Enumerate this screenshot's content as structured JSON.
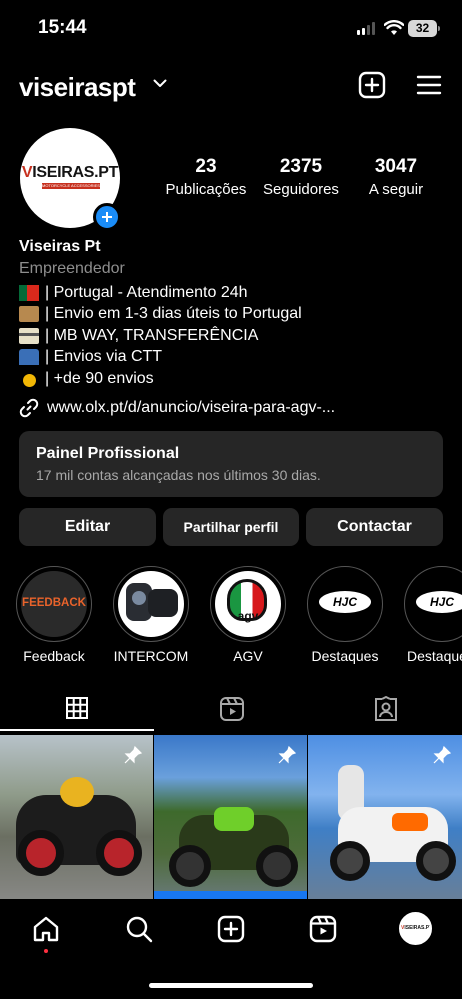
{
  "status_bar": {
    "time": "15:44",
    "battery": "32"
  },
  "header": {
    "username": "viseiraspt"
  },
  "avatar": {
    "logo_text_v": "V",
    "logo_text_rest": "ISEIRAS.PT",
    "logo_subtext": "MOTORCYCLE ACCESSORIES"
  },
  "stats": [
    {
      "value": "23",
      "label": "Publicações"
    },
    {
      "value": "2375",
      "label": "Seguidores"
    },
    {
      "value": "3047",
      "label": "A seguir"
    }
  ],
  "bio": {
    "name": "Viseiras Pt",
    "category": "Empreendedor",
    "lines": [
      {
        "emoji": "🇵🇹",
        "text": "| Portugal - Atendimento 24h"
      },
      {
        "emoji": "📦",
        "text": "| Envio em 1-3 dias úteis to Portugal"
      },
      {
        "emoji": "💳",
        "text": "| MB WAY, TRANSFERÊNCIA"
      },
      {
        "emoji": "📫",
        "text": "| Envios via CTT"
      },
      {
        "emoji": "🥇",
        "text": "| +de 90 envios"
      }
    ],
    "link": "www.olx.pt/d/anuncio/viseira-para-agv-..."
  },
  "professional_panel": {
    "title": "Painel Profissional",
    "subtitle": "17 mil contas alcançadas nos últimos 30 dias."
  },
  "buttons": {
    "edit": "Editar",
    "share": "Partilhar perfil",
    "contact": "Contactar"
  },
  "highlights": [
    {
      "label": "Feedback",
      "cover_text": "FEEDBACK"
    },
    {
      "label": "INTERCOM",
      "cover_text": ""
    },
    {
      "label": "AGV",
      "cover_text": "agv"
    },
    {
      "label": "Destaques",
      "cover_text": "HJC"
    },
    {
      "label": "Destaques",
      "cover_text": "HJC"
    }
  ],
  "tabs": [
    "grid-icon",
    "reels-icon",
    "tagged-icon"
  ],
  "nav": [
    "home-icon",
    "search-icon",
    "create-icon",
    "reels-icon",
    "profile-avatar"
  ],
  "colors": {
    "accent_blue": "#1a8cf7",
    "panel_bg": "#262626",
    "muted_text": "#8e8e8e",
    "brand_red": "#c7311f"
  }
}
